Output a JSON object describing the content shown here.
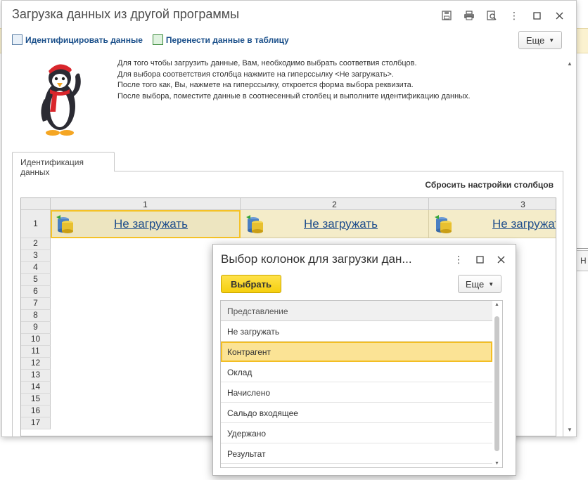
{
  "main_window": {
    "title": "Загрузка данных из другой программы",
    "commands": {
      "identify": "Идентифицировать данные",
      "transfer": "Перенести данные в таблицу",
      "more": "Еще"
    },
    "info_lines": [
      "Для того чтобы загрузить данные, Вам, необходимо выбрать соответвия столбцов.",
      "Для выбора соответствия столбца нажмите на гиперссылку <Не загружать>.",
      "После того как, Вы, нажмете на гиперссылку, откроется форма выбора реквизита.",
      "После выбора, поместите данные в соотнесенный столбец и выполните идентификацию данных."
    ],
    "tab_label": "Идентификация данных",
    "reset_columns": "Сбросить настройки столбцов",
    "grid": {
      "columns": [
        "1",
        "2",
        "3"
      ],
      "cell_link": "Не загружать",
      "rows": [
        "1",
        "2",
        "3",
        "4",
        "5",
        "6",
        "7",
        "8",
        "9",
        "10",
        "11",
        "12",
        "13",
        "14",
        "15",
        "16",
        "17"
      ]
    }
  },
  "background": {
    "right_button": "Н"
  },
  "popup": {
    "title": "Выбор колонок для загрузки дан...",
    "select_button": "Выбрать",
    "more": "Еще",
    "column_header": "Представление",
    "items": [
      "Не загружать",
      "Контрагент",
      "Оклад",
      "Начислено",
      "Сальдо входящее",
      "Удержано",
      "Результат"
    ],
    "selected_index": 1
  },
  "colors": {
    "accent_yellow": "#f5cf0f",
    "link_blue": "#1f4e8c",
    "selection": "#fbe395"
  }
}
